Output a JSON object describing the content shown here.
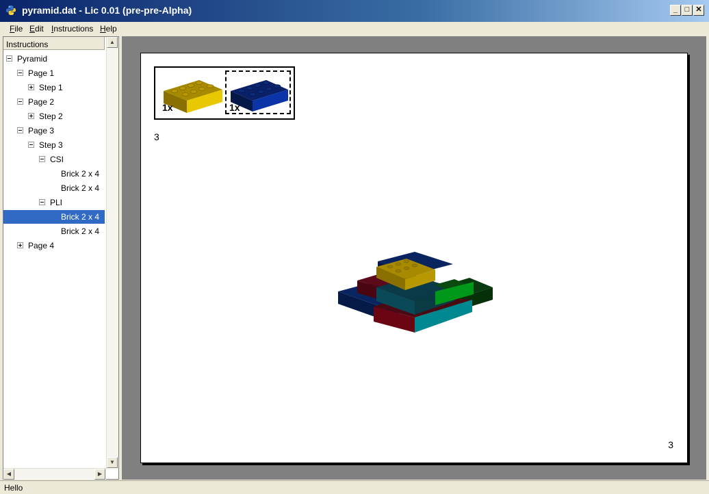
{
  "window": {
    "title": "pyramid.dat - Lic 0.01 (pre-pre-Alpha)"
  },
  "menu": [
    {
      "ul": "F",
      "rest": "ile"
    },
    {
      "ul": "E",
      "rest": "dit"
    },
    {
      "ul": "I",
      "rest": "nstructions"
    },
    {
      "ul": "H",
      "rest": "elp"
    }
  ],
  "tree": {
    "header": "Instructions",
    "nodes": [
      {
        "label": "Pyramid",
        "expander": "minus"
      },
      {
        "label": "Page 1",
        "expander": "minus"
      },
      {
        "label": "Step 1",
        "expander": "plus"
      },
      {
        "label": "Page 2",
        "expander": "minus"
      },
      {
        "label": "Step 2",
        "expander": "plus"
      },
      {
        "label": "Page 3",
        "expander": "minus"
      },
      {
        "label": "Step 3",
        "expander": "minus"
      },
      {
        "label": "CSI",
        "expander": "minus"
      },
      {
        "label": "Brick 2 x 4",
        "expander": "none"
      },
      {
        "label": "Brick 2 x 4",
        "expander": "none"
      },
      {
        "label": "PLI",
        "expander": "minus"
      },
      {
        "label": "Brick 2 x 4",
        "expander": "none",
        "selected": true
      },
      {
        "label": "Brick 2 x 4",
        "expander": "none"
      },
      {
        "label": "Page 4",
        "expander": "plus"
      }
    ]
  },
  "page": {
    "pli": [
      {
        "qty": "1x",
        "color": "#e0c000",
        "selected": false
      },
      {
        "qty": "1x",
        "color": "#0a2e8a",
        "selected": true
      }
    ],
    "step_number": "3",
    "page_number": "3"
  },
  "status": "Hello",
  "colors": {
    "selection": "#316ac5",
    "title_bar": "#0a246a"
  }
}
